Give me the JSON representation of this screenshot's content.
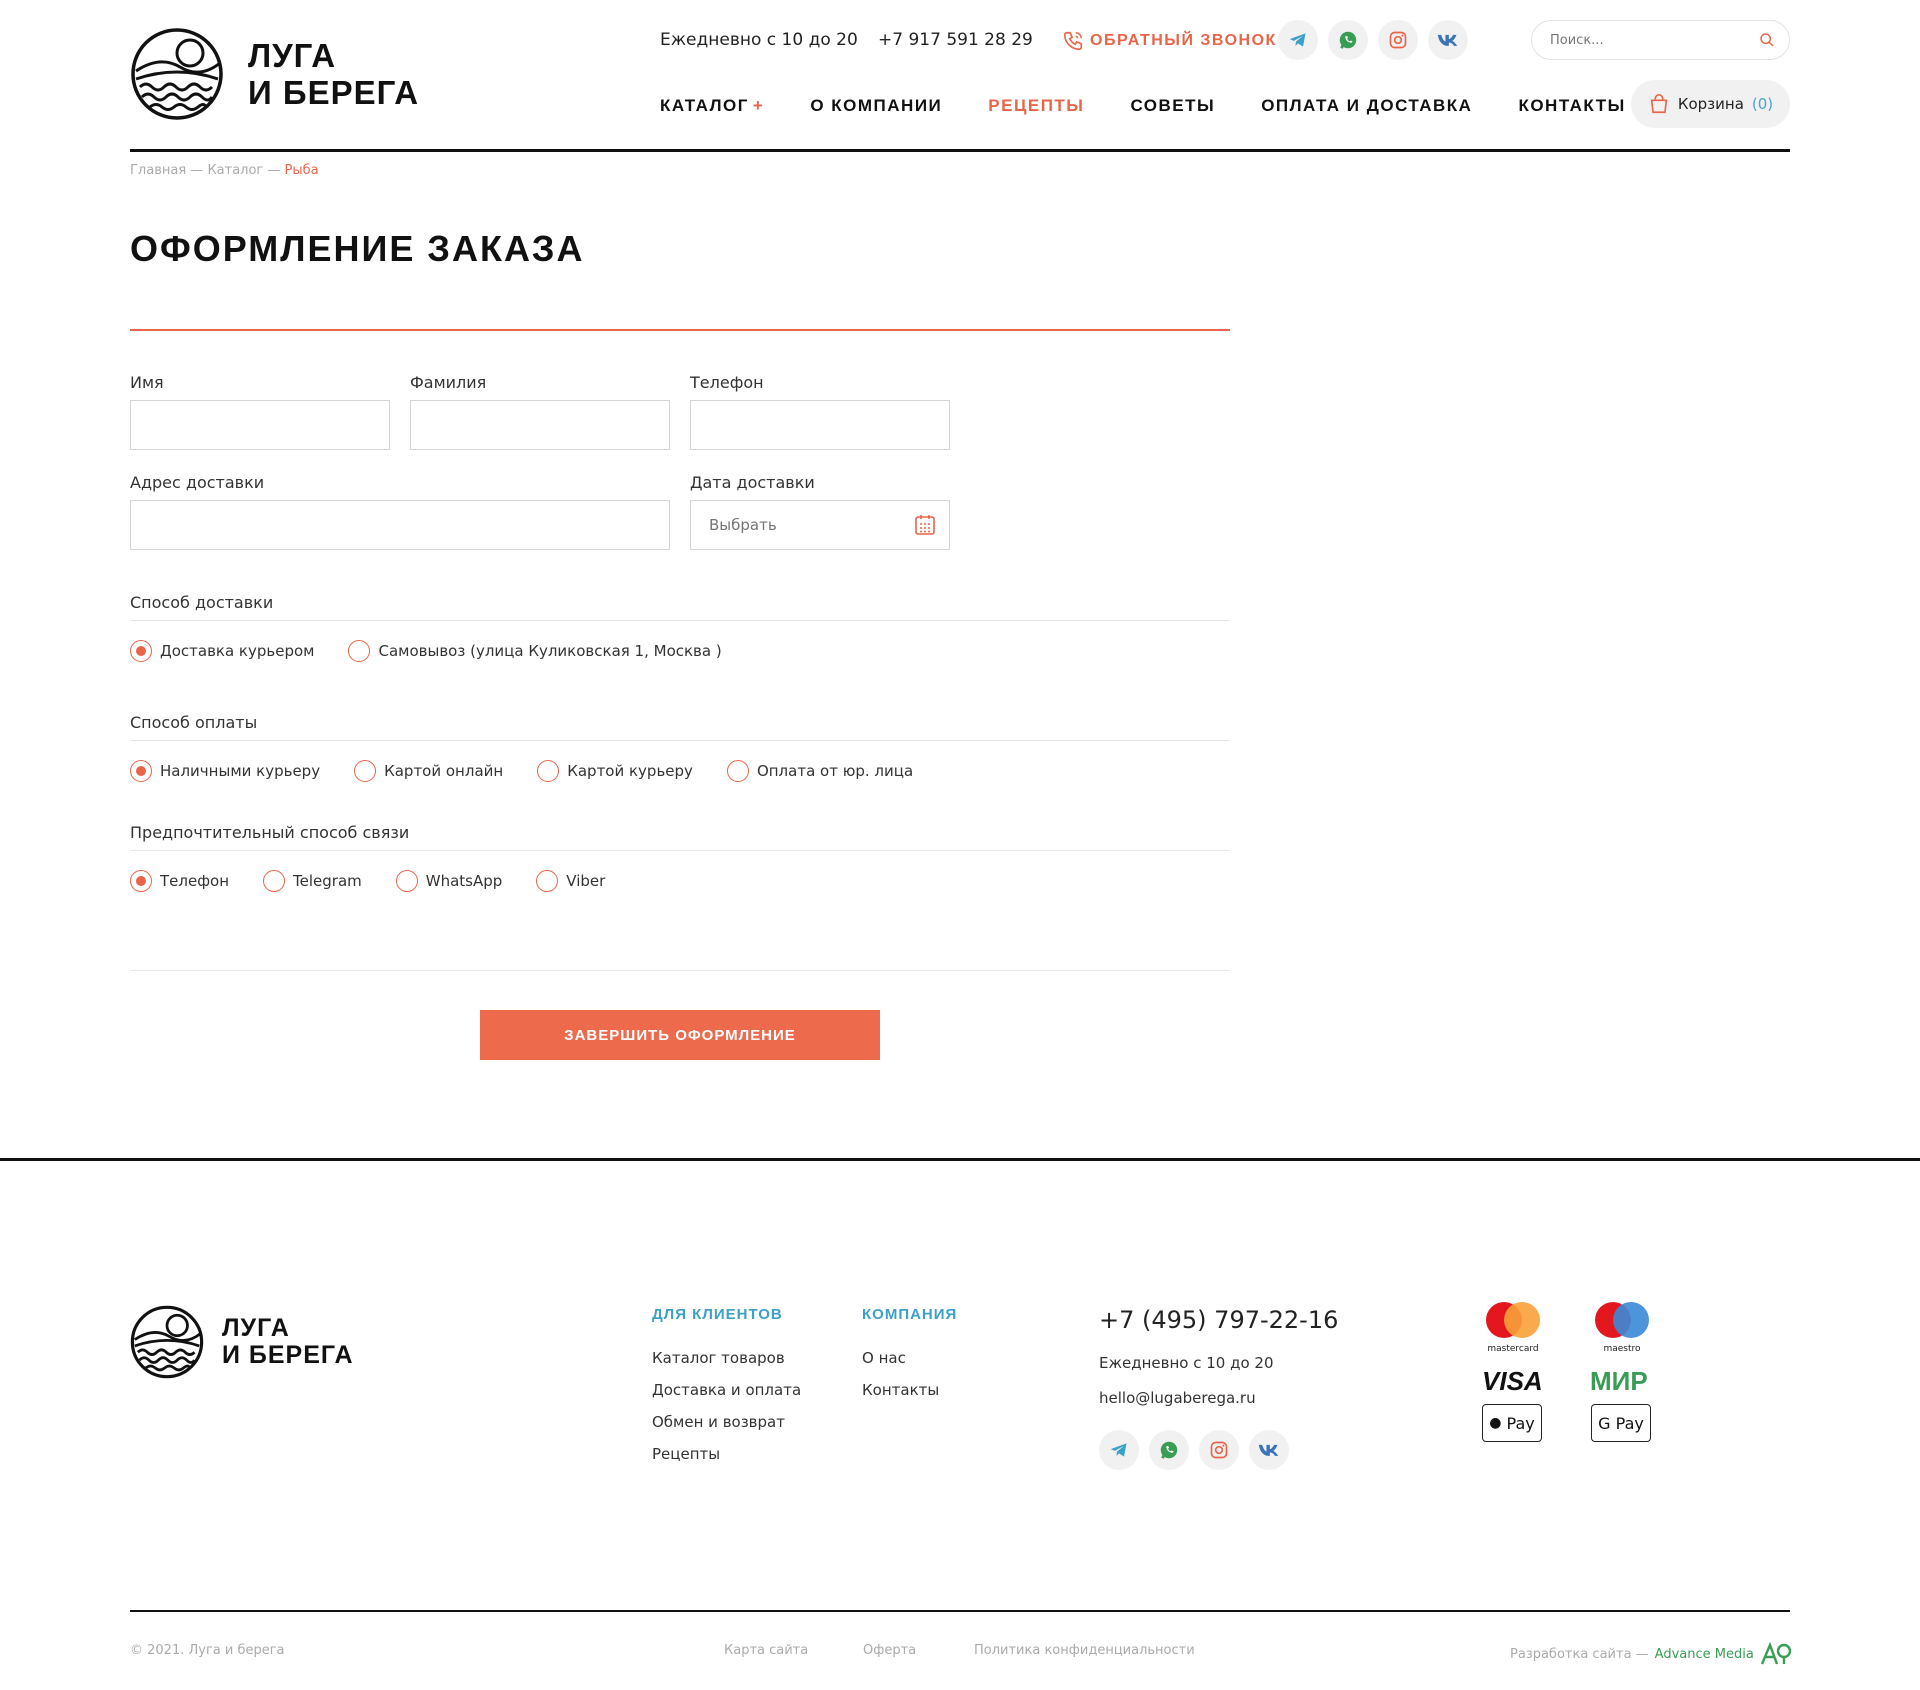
{
  "header": {
    "logo_line1": "ЛУГА",
    "logo_line2": "И БЕРЕГА",
    "hours": "Ежедневно с 10 до 20",
    "phone": "+7 917 591 28 29",
    "callback": "ОБРАТНЫЙ ЗВОНОК",
    "search_placeholder": "Поиск...",
    "nav": [
      "КАТАЛОГ",
      "О КОМПАНИИ",
      "РЕЦЕПТЫ",
      "СОВЕТЫ",
      "ОПЛАТА И ДОСТАВКА",
      "КОНТАКТЫ"
    ],
    "nav_plus": "+",
    "cart_label": "Корзина",
    "cart_count": "(0)",
    "socials": [
      "telegram-icon",
      "whatsapp-icon",
      "instagram-icon",
      "vk-icon"
    ]
  },
  "breadcrumb": {
    "home": "Главная",
    "sep": "—",
    "catalog": "Каталог",
    "current": "Рыба"
  },
  "page_title": "ОФОРМЛЕНИЕ ЗАКАЗА",
  "form": {
    "first_name_label": "Имя",
    "last_name_label": "Фамилия",
    "phone_label": "Телефон",
    "address_label": "Адрес доставки",
    "date_label": "Дата доставки",
    "date_placeholder": "Выбрать",
    "delivery_title": "Способ доставки",
    "delivery_options": [
      "Доставка курьером",
      "Самовывоз (улица Куликовская 1, Москва )"
    ],
    "payment_title": "Способ оплаты",
    "payment_options": [
      "Наличными курьеру",
      "Картой онлайн",
      "Картой курьеру",
      "Оплата от юр. лица"
    ],
    "contact_title": "Предпочтительный способ связи",
    "contact_options": [
      "Телефон",
      "Telegram",
      "WhatsApp",
      "Viber"
    ],
    "submit": "ЗАВЕРШИТЬ ОФОРМЛЕНИЕ"
  },
  "footer": {
    "clients_title": "ДЛЯ КЛИЕНТОВ",
    "clients_links": [
      "Каталог товаров",
      "Доставка и оплата",
      "Обмен и возврат",
      "Рецепты"
    ],
    "company_title": "КОМПАНИЯ",
    "company_links": [
      "О нас",
      "Контакты"
    ],
    "phone": "+7 (495) 797-22-16",
    "hours": "Ежедневно с 10 до 20",
    "email": "hello@lugaberega.ru",
    "payments": {
      "mastercard": "mastercard",
      "maestro": "maestro",
      "visa": "VISA",
      "mir": "МИР",
      "apple": "Pay",
      "google": "G Pay"
    },
    "copyright": "© 2021. Луга и берега",
    "sitemap": "Карта сайта",
    "offer": "Оферта",
    "privacy": "Политика конфиденциальности",
    "dev_label": "Разработка сайта —",
    "dev_name": "Advance Media"
  },
  "colors": {
    "accent": "#e8654a",
    "link_blue": "#3da0c7",
    "green": "#3a9d55"
  }
}
